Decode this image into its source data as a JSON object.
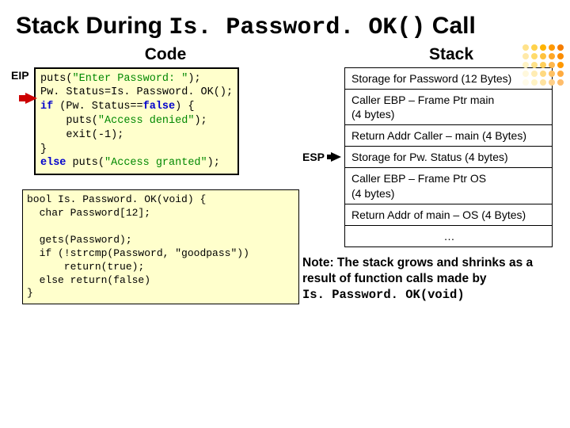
{
  "title_parts": {
    "a": "Stack During ",
    "b": "Is. Password. OK()",
    "c": " Call"
  },
  "headings": {
    "code": "Code",
    "stack": "Stack"
  },
  "labels": {
    "eip": "EIP",
    "esp": "ESP"
  },
  "code1": {
    "l1a": "puts(",
    "l1s": "\"Enter Password: \"",
    "l1b": ");",
    "l2": "Pw. Status=Is. Password. OK();",
    "l3a": "if",
    "l3b": " (Pw. Status==",
    "l3c": "false",
    "l3d": ") {",
    "l4a": "    puts(",
    "l4s": "\"Access denied\"",
    "l4b": ");",
    "l5": "    exit(-1);",
    "l6": "}",
    "l7a": "else",
    "l7b": " puts(",
    "l7s": "\"Access granted\"",
    "l7c": ");"
  },
  "code2": {
    "l1a": "bool",
    "l1b": " Is. Password. OK(",
    "l1c": "void",
    "l1d": ") {",
    "l2a": "  char",
    "l2b": " Password[12];",
    "l3": "",
    "l4": "  gets(Password);",
    "l5a": "  if",
    "l5b": " (!strcmp(Password, ",
    "l5s": "\"goodpass\"",
    "l5c": "))",
    "l6a": "      return(",
    "l6b": "true",
    "l6c": ");",
    "l7a": "  else return(",
    "l7b": "false",
    "l7c": ")",
    "l8": "}"
  },
  "stack_cells": [
    "Storage for Password (12 Bytes)",
    "Caller EBP – Frame Ptr main\n    (4 bytes)",
    "Return Addr Caller – main (4 Bytes)",
    "Storage for Pw. Status (4 bytes)",
    "Caller EBP – Frame Ptr OS\n    (4 bytes)",
    "Return Addr of main – OS (4 Bytes)",
    "…"
  ],
  "note": {
    "a": "Note: The stack grows and shrinks as a result of function calls made by",
    "b": "Is. Password. OK(void)"
  },
  "dot_colors": [
    "#ffe28a",
    "#ffd24a",
    "#ffb300",
    "#ff9800",
    "#f57c00",
    "#ffe9a8",
    "#ffdb6b",
    "#ffc23d",
    "#ffa726",
    "#fb8c00",
    "#fff3c4",
    "#ffe28a",
    "#ffcf5c",
    "#ffb74d",
    "#ff9800",
    "#fff8dc",
    "#ffecb3",
    "#ffd980",
    "#ffc163",
    "#ffab40",
    "#fffbe9",
    "#fff3c4",
    "#ffe3a0",
    "#ffcf87",
    "#ffbd6b"
  ]
}
